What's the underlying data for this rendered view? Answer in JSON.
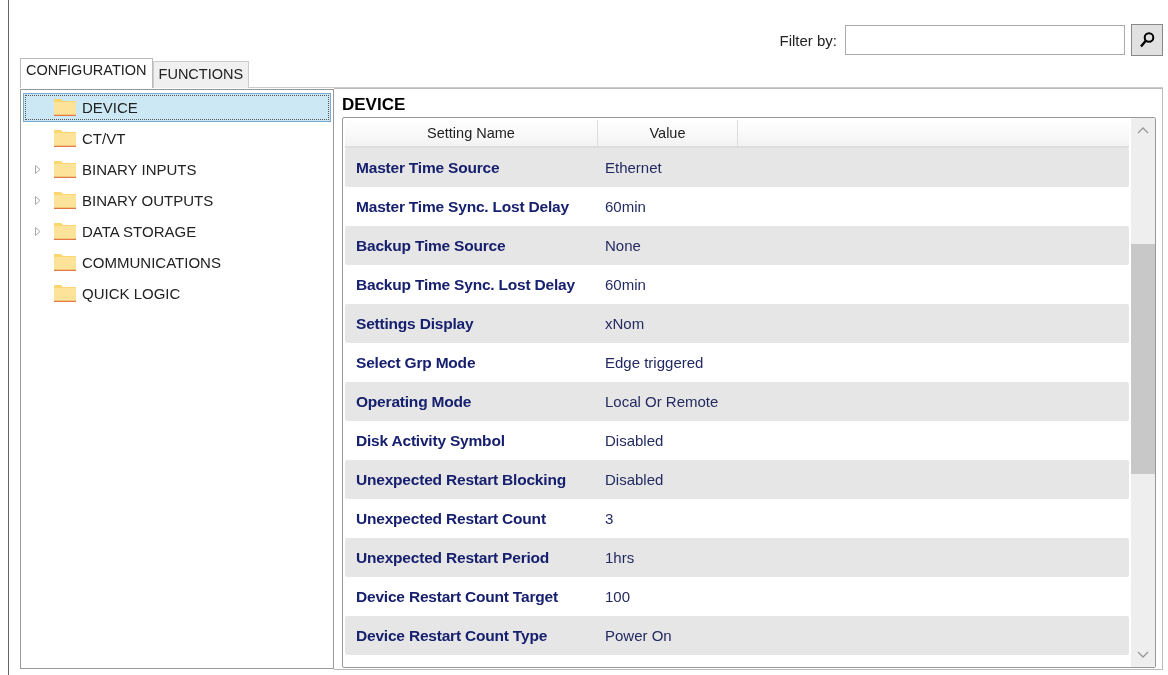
{
  "filter": {
    "label": "Filter by:"
  },
  "tabs": [
    {
      "label": "CONFIGURATION",
      "selected": true
    },
    {
      "label": "FUNCTIONS",
      "selected": false
    }
  ],
  "tree": [
    {
      "label": "DEVICE",
      "selected": true
    },
    {
      "label": "CT/VT",
      "selected": false
    },
    {
      "label": "BINARY INPUTS",
      "selected": false,
      "expanded": false
    },
    {
      "label": "BINARY OUTPUTS",
      "selected": false,
      "expanded": false
    },
    {
      "label": "DATA STORAGE",
      "selected": false,
      "expanded": false
    },
    {
      "label": "COMMUNICATIONS",
      "selected": false
    },
    {
      "label": "QUICK LOGIC",
      "selected": false
    }
  ],
  "panel": {
    "title": "DEVICE"
  },
  "table": {
    "columns": [
      "Setting Name",
      "Value"
    ],
    "rows": [
      [
        "Master Time Source",
        "Ethernet"
      ],
      [
        "Master Time Sync. Lost Delay",
        "60min"
      ],
      [
        "Backup Time Source",
        "None"
      ],
      [
        "Backup Time Sync. Lost Delay",
        "60min"
      ],
      [
        "Settings Display",
        "xNom"
      ],
      [
        "Select Grp Mode",
        "Edge triggered"
      ],
      [
        "Operating Mode",
        "Local Or Remote"
      ],
      [
        "Disk Activity Symbol",
        "Disabled"
      ],
      [
        "Unexpected Restart Blocking",
        "Disabled"
      ],
      [
        "Unexpected Restart Count",
        "3"
      ],
      [
        "Unexpected Restart Period",
        "1hrs"
      ],
      [
        "Device Restart Count Target",
        "100"
      ],
      [
        "Device Restart Count Type",
        "Power On"
      ]
    ]
  }
}
